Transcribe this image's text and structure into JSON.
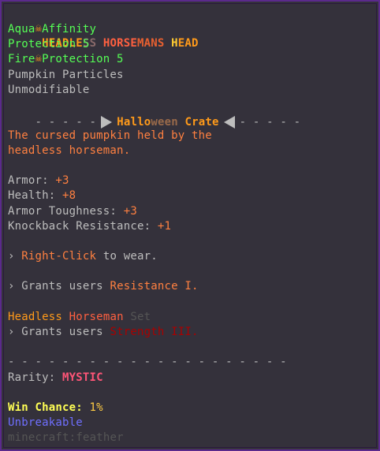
{
  "title": {
    "icon_left": "☠",
    "segments": [
      {
        "text": "HEADLE",
        "color": "#ff9a1a"
      },
      {
        "text": "SS ",
        "color": "#8a6a6a"
      },
      {
        "text": "HORSE",
        "color": "#ff6040"
      },
      {
        "text": "MANS ",
        "color": "#e86030"
      },
      {
        "text": "H",
        "color": "#ffcc33"
      },
      {
        "text": "EAD",
        "color": "#ff9a1a"
      }
    ],
    "icon_right": "☠",
    "icon_name": "skull-crossbones-icon"
  },
  "enchantments": [
    "Aqua Affinity",
    "Protection 5",
    "Fire Protection 5"
  ],
  "effects": [
    "Pumpkin Particles",
    "Unmodifiable"
  ],
  "crate_divider": {
    "dashes_left": "- - - - -",
    "crate_part1": "Hallo",
    "crate_part2": "ween",
    "crate_part3": " Crate",
    "dashes_right": "- - - - -"
  },
  "description": [
    "The cursed pumpkin held by the",
    "headless horseman."
  ],
  "stats": [
    {
      "label": "Armor: ",
      "value": "+3"
    },
    {
      "label": "Health: ",
      "value": "+8"
    },
    {
      "label": "Armor Toughness: ",
      "value": "+3"
    },
    {
      "label": "Knockback Resistance: ",
      "value": "+1"
    }
  ],
  "ability1": {
    "prefix": "› ",
    "action": "Right-Click",
    "suffix": " to wear."
  },
  "ability2": {
    "prefix": "› Grants users ",
    "effect": "Resistance I."
  },
  "set": {
    "name_part1": "Headless ",
    "name_part2": "Horseman",
    "name_part3": " Set",
    "bonus_prefix": "› Grants users ",
    "bonus_effect": "Strength III."
  },
  "bottom_divider": "- - - - - - - - - - - - - - - - - - - - -",
  "rarity": {
    "label": "Rarity: ",
    "value": "MYSTIC"
  },
  "win_chance": {
    "label": "Win Chance: ",
    "value": "1%"
  },
  "unbreakable": "Unbreakable",
  "item_id": {
    "namespace": "minecraft",
    "id": "feather"
  }
}
